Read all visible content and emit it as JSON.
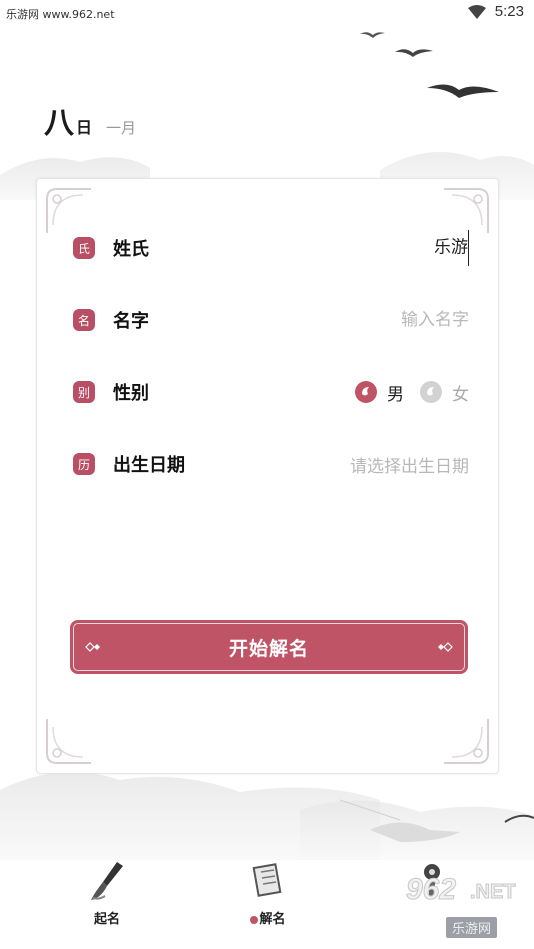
{
  "status_bar": {
    "watermark_text": "乐游网 www.962.net",
    "time": "5:23"
  },
  "date_header": {
    "day_big": "八",
    "day_small": "日",
    "month": "一月"
  },
  "form": {
    "surname": {
      "seal": "氏",
      "label": "姓氏",
      "value": "乐游"
    },
    "given_name": {
      "seal": "名",
      "label": "名字",
      "placeholder": "输入名字"
    },
    "gender": {
      "seal": "别",
      "label": "性别",
      "options": [
        "男",
        "女"
      ],
      "selected": "男"
    },
    "birth_date": {
      "seal": "历",
      "label": "出生日期",
      "placeholder": "请选择出生日期"
    },
    "submit_label": "开始解名"
  },
  "bottom_nav": {
    "items": [
      {
        "label": "起名",
        "icon": "brush-icon"
      },
      {
        "label": "解名",
        "icon": "scroll-icon"
      },
      {
        "label": "",
        "icon": "compass-icon"
      }
    ]
  },
  "watermark": {
    "logo": "962",
    "suffix": ".NET",
    "sub": "乐游网"
  },
  "colors": {
    "accent": "#c05467",
    "seal": "#b84f64",
    "placeholder": "#b8b8b8"
  }
}
